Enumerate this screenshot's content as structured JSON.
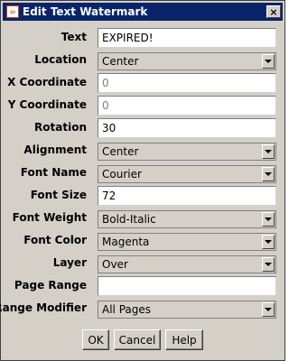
{
  "window": {
    "title": "Edit Text Watermark",
    "icon": "java-cup-icon",
    "close_glyph": "×"
  },
  "fields": [
    {
      "label": "Text",
      "kind": "text",
      "value": "EXPIRED!"
    },
    {
      "label": "Location",
      "kind": "select",
      "value": "Center"
    },
    {
      "label": "X Coordinate",
      "kind": "text",
      "value": "0",
      "disabled": true
    },
    {
      "label": "Y Coordinate",
      "kind": "text",
      "value": "0",
      "disabled": true
    },
    {
      "label": "Rotation",
      "kind": "text",
      "value": "30"
    },
    {
      "label": "Alignment",
      "kind": "select",
      "value": "Center"
    },
    {
      "label": "Font Name",
      "kind": "select",
      "value": "Courier"
    },
    {
      "label": "Font Size",
      "kind": "text",
      "value": "72"
    },
    {
      "label": "Font Weight",
      "kind": "select",
      "value": "Bold-Italic"
    },
    {
      "label": "Font Color",
      "kind": "select",
      "value": "Magenta"
    },
    {
      "label": "Layer",
      "kind": "select",
      "value": "Over"
    },
    {
      "label": "Page Range",
      "kind": "text",
      "value": ""
    },
    {
      "label": "Range Modifier",
      "kind": "select",
      "value": "All Pages"
    }
  ],
  "buttons": {
    "ok": "OK",
    "cancel": "Cancel",
    "help": "Help"
  },
  "colors": {
    "titlebar": "#0a246a",
    "dialog_bg": "#d4d0c8",
    "disabled_text": "#808080"
  }
}
